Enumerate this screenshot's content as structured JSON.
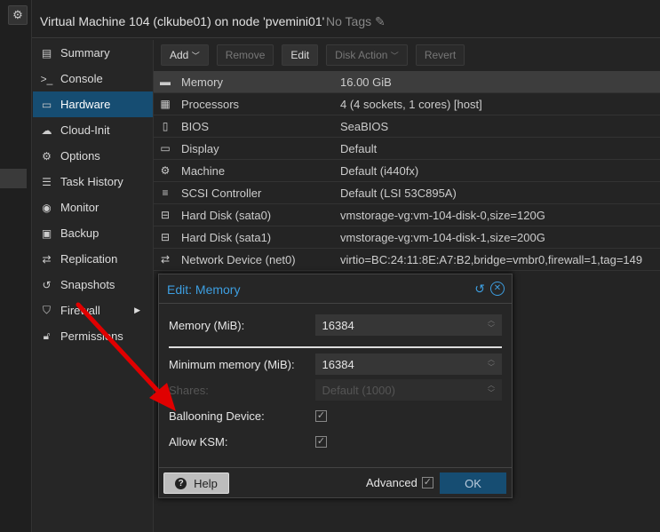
{
  "header": {
    "title": "Virtual Machine 104 (clkube01) on node 'pvemini01'",
    "tags": "No Tags"
  },
  "sidebar": {
    "items": [
      {
        "label": "Summary",
        "icon": "book-icon"
      },
      {
        "label": "Console",
        "icon": "terminal-icon"
      },
      {
        "label": "Hardware",
        "icon": "desktop-icon"
      },
      {
        "label": "Cloud-Init",
        "icon": "cloud-icon"
      },
      {
        "label": "Options",
        "icon": "gear-icon"
      },
      {
        "label": "Task History",
        "icon": "list-icon"
      },
      {
        "label": "Monitor",
        "icon": "eye-icon"
      },
      {
        "label": "Backup",
        "icon": "floppy-icon"
      },
      {
        "label": "Replication",
        "icon": "retweet-icon"
      },
      {
        "label": "Snapshots",
        "icon": "history-icon"
      },
      {
        "label": "Firewall",
        "icon": "shield-icon"
      },
      {
        "label": "Permissions",
        "icon": "unlock-icon"
      }
    ]
  },
  "toolbar": {
    "add": "Add",
    "remove": "Remove",
    "edit": "Edit",
    "disk_action": "Disk Action",
    "revert": "Revert"
  },
  "hardware": [
    {
      "key": "Memory",
      "value": "16.00 GiB"
    },
    {
      "key": "Processors",
      "value": "4 (4 sockets, 1 cores) [host]"
    },
    {
      "key": "BIOS",
      "value": "SeaBIOS"
    },
    {
      "key": "Display",
      "value": "Default"
    },
    {
      "key": "Machine",
      "value": "Default (i440fx)"
    },
    {
      "key": "SCSI Controller",
      "value": "Default (LSI 53C895A)"
    },
    {
      "key": "Hard Disk (sata0)",
      "value": "vmstorage-vg:vm-104-disk-0,size=120G"
    },
    {
      "key": "Hard Disk (sata1)",
      "value": "vmstorage-vg:vm-104-disk-1,size=200G"
    },
    {
      "key": "Network Device (net0)",
      "value": "virtio=BC:24:11:8E:A7:B2,bridge=vmbr0,firewall=1,tag=149"
    }
  ],
  "dialog": {
    "title": "Edit: Memory",
    "memory_label": "Memory (MiB):",
    "memory_value": "16384",
    "min_label": "Minimum memory (MiB):",
    "min_value": "16384",
    "shares_label": "Shares:",
    "shares_placeholder": "Default (1000)",
    "ballooning_label": "Ballooning Device:",
    "ksm_label": "Allow KSM:",
    "help": "Help",
    "advanced": "Advanced",
    "ok": "OK"
  },
  "colors": {
    "accent": "#164d72",
    "title": "#3d9ee0",
    "annotation": "#e00000"
  }
}
